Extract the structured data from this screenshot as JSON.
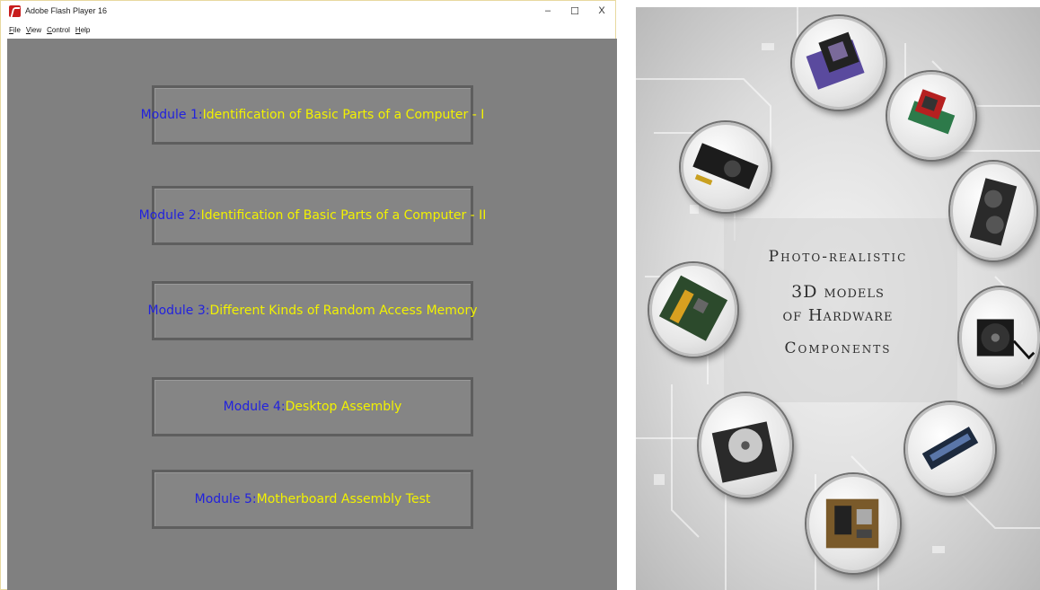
{
  "window": {
    "title": "Adobe Flash Player 16",
    "controls": {
      "minimize": "–",
      "maximize": "☐",
      "close": "X"
    },
    "menu": [
      {
        "accel": "F",
        "rest": "ile"
      },
      {
        "accel": "V",
        "rest": "iew"
      },
      {
        "accel": "C",
        "rest": "ontrol"
      },
      {
        "accel": "H",
        "rest": "elp"
      }
    ]
  },
  "modules": [
    {
      "number": "Module 1: ",
      "title": "Identification of Basic Parts of a Computer - I"
    },
    {
      "number": "Module 2: ",
      "title": "Identification of Basic Parts of a Computer - II"
    },
    {
      "number": "Module 3: ",
      "title": "Different Kinds of Random Access Memory"
    },
    {
      "number": "Module 4: ",
      "title": "Desktop Assembly"
    },
    {
      "number": "Module 5: ",
      "title": "Motherboard Assembly Test"
    }
  ],
  "poster": {
    "line1": "Photo-realistic",
    "line2": "3D models",
    "line3": "of Hardware",
    "line4": "Components"
  },
  "colors": {
    "stage_bg": "#808080",
    "module_number": "#2222dd",
    "module_title": "#f2f200",
    "flash_icon": "#c81d1d"
  },
  "icons": {
    "app": "flash-player-icon",
    "hardware": [
      "cpu-chip-icon",
      "graphics-card-icon",
      "video-card-icon",
      "cooling-fan-icon",
      "ram-module-icon",
      "motherboard-icon",
      "hard-drive-icon",
      "motherboard-board-icon",
      "gpu-card-icon"
    ]
  }
}
